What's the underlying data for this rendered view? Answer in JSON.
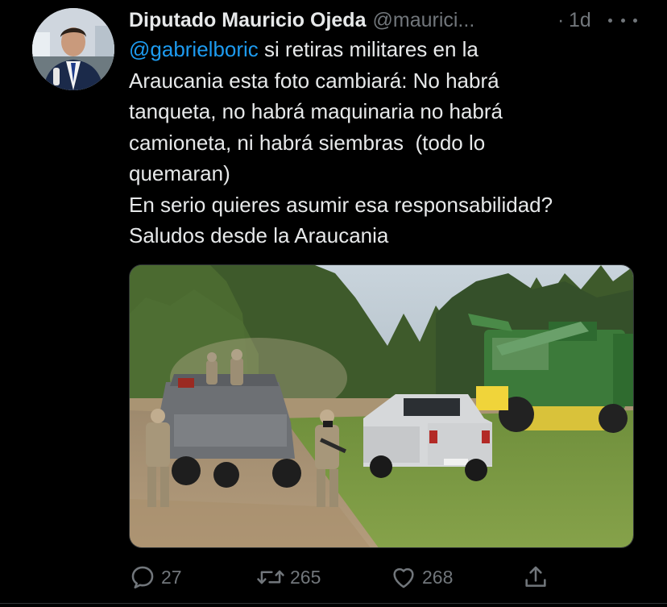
{
  "tweet": {
    "author": {
      "display_name": "Diputado Mauricio Ojeda",
      "handle": "@maurici...",
      "avatar_icon": "person-in-suit-avatar"
    },
    "separator": "·",
    "time": "1d",
    "more_icon": "more-horizontal-icon",
    "text": {
      "mention": "@gabrielboric",
      "line1_rest": " si retiras militares en la",
      "line2": "Araucania esta foto cambiará: No habrá",
      "line3": "tanqueta, no habrá maquinaria no habrá",
      "line4": "camioneta, ni habrá siembras  (todo lo",
      "line5": "quemaran)",
      "line6": "En serio quieres asumir esa responsabilidad?",
      "line7": "Saludos desde la Araucania"
    },
    "media": {
      "type": "photo"
    },
    "actions": {
      "reply": {
        "icon": "reply-icon",
        "count": "27"
      },
      "retweet": {
        "icon": "retweet-icon",
        "count": "265"
      },
      "like": {
        "icon": "heart-icon",
        "count": "268"
      },
      "share": {
        "icon": "share-icon"
      }
    }
  },
  "colors": {
    "background": "#000000",
    "text": "#e7e9ea",
    "secondary": "#71767b",
    "link": "#1d9bf0"
  }
}
